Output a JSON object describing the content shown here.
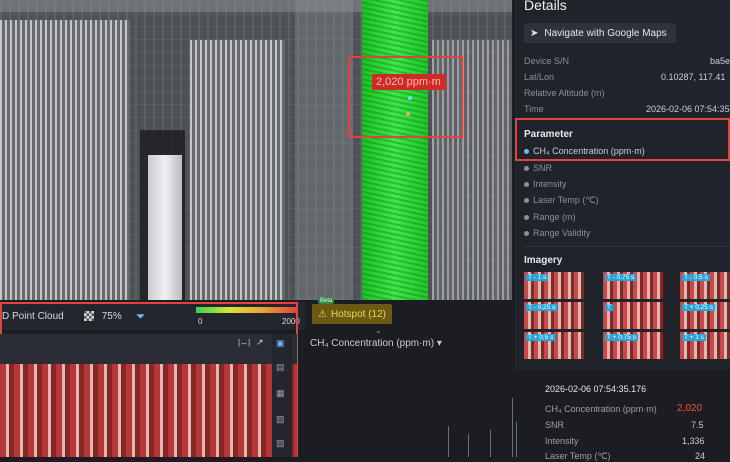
{
  "details": {
    "title": "Details",
    "navigate_label": "Navigate with Google Maps",
    "device_sn_label": "Device S/N",
    "device_sn_value": "ba5e",
    "latlon_label": "Lat/Lon",
    "latlon_value": "0.10287, 117.41",
    "rel_alt_label": "Relative Altitude (m)",
    "time_label": "Time",
    "time_value": "2026-02-06 07:54:35"
  },
  "parameter": {
    "title": "Parameter",
    "items": [
      "CH₄ Concentration (ppm·m)",
      "SNR",
      "Intensity",
      "Laser Temp (℃)",
      "Range (m)",
      "Range Validity"
    ]
  },
  "imagery": {
    "title": "Imagery",
    "thumbs": [
      "T - 1 s",
      "T - 0.75 s",
      "T - 0.5 s",
      "T - 0.25 s",
      "T",
      "T + 0.25 s",
      "T + 0.5 s",
      "T + 0.75 s",
      "T + 1 s"
    ]
  },
  "map": {
    "hotspot_label": "2,020 ppm·m"
  },
  "toolbar": {
    "point_cloud_label": "D Point Cloud",
    "opacity_value": "75%",
    "scale_min": "0",
    "scale_max": "2000",
    "hotspot_label": "Hotspot (12)",
    "badge_new": "Beta"
  },
  "chart": {
    "selector_label": "CH₄ Concentration (ppm·m) ▾"
  },
  "reading": {
    "timestamp": "2026-02-06 07:54:35.176",
    "rows": [
      {
        "label": "CH₄ Concentration (ppm·m)",
        "value": "2,020"
      },
      {
        "label": "SNR",
        "value": "7.5"
      },
      {
        "label": "Intensity",
        "value": "1,336"
      },
      {
        "label": "Laser Temp (℃)",
        "value": "24"
      }
    ]
  },
  "colors": {
    "accent_red": "#e0443c",
    "plume_green": "#3fe84a",
    "hotspot_yellow": "#f1d35a",
    "value_red": "#ff4b3e"
  }
}
